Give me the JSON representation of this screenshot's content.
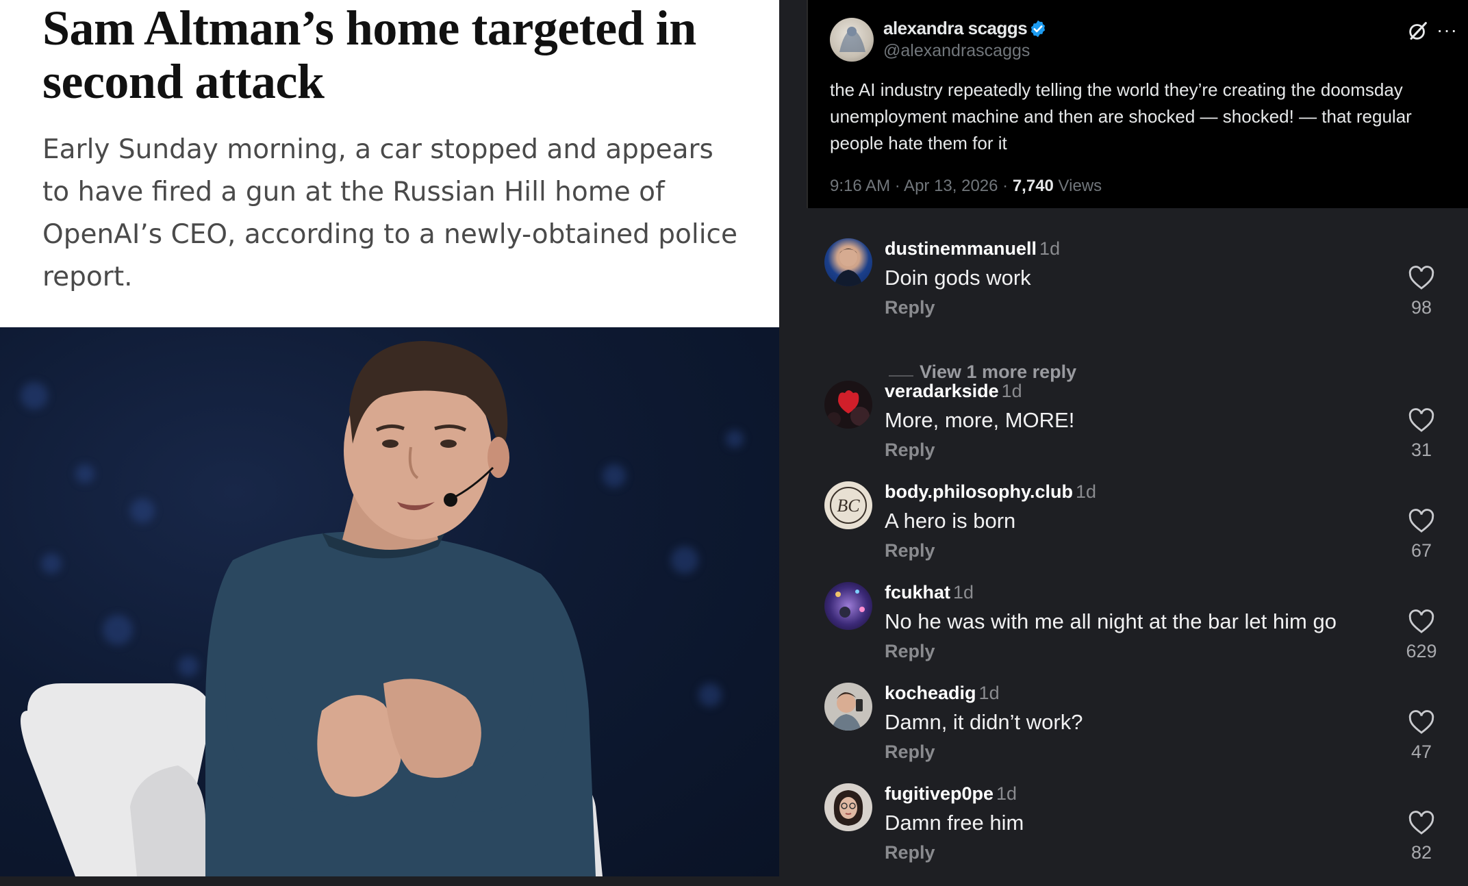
{
  "article": {
    "headline": "Sam Altman’s home targeted in second attack",
    "dek": "Early Sunday morning, a car stopped and appears to have fired a gun at the Russian Hill home of OpenAI’s CEO, according to a newly-obtained police report."
  },
  "tweet": {
    "name": "alexandra scaggs",
    "handle": "@alexandrascaggs",
    "text": "the AI industry repeatedly telling the world they’re creating the doomsday unemployment machine and then are shocked — shocked! — that regular people hate them for it",
    "time": "9:16 AM · Apr 13, 2026 · ",
    "views_count": "7,740",
    "views_label": " Views",
    "more": "···"
  },
  "comments": {
    "reply_label": "Reply",
    "view_more": "View 1 more reply",
    "items": [
      {
        "user": "dustinemmanuell",
        "time": "1d",
        "text": "Doin gods work",
        "likes": "98"
      },
      {
        "user": "veradarkside",
        "time": "1d",
        "text": "More, more, MORE!",
        "likes": "31"
      },
      {
        "user": "body.philosophy.club",
        "time": "1d",
        "text": "A hero is born",
        "likes": "67"
      },
      {
        "user": "fcukhat",
        "time": "1d",
        "text": "No he was with me all night at the bar let him go",
        "likes": "629"
      },
      {
        "user": "kocheadig",
        "time": "1d",
        "text": "Damn, it didn’t work?",
        "likes": "47"
      },
      {
        "user": "fugitivep0pe",
        "time": "1d",
        "text": "Damn free him",
        "likes": "82"
      }
    ]
  },
  "colors": {
    "verified": "#1d9bf0",
    "comment_bg": "#1e1f23",
    "tweet_bg": "#000000"
  }
}
